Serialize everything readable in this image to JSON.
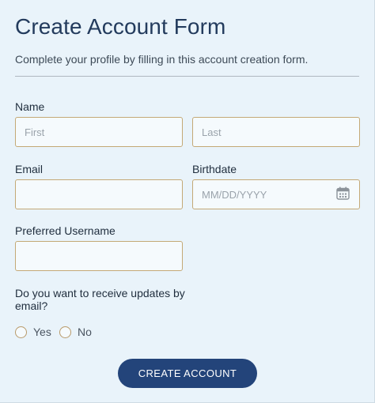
{
  "form": {
    "title": "Create Account Form",
    "subtitle": "Complete your profile by filling in this account creation form."
  },
  "fields": {
    "name_label": "Name",
    "first_placeholder": "First",
    "last_placeholder": "Last",
    "email_label": "Email",
    "email_value": "",
    "birthdate_label": "Birthdate",
    "birthdate_placeholder": "MM/DD/YYYY",
    "birthdate_icon": "calendar-icon",
    "username_label": "Preferred Username",
    "username_value": ""
  },
  "updates": {
    "question": "Do you want to receive updates by email?",
    "options": [
      "Yes",
      "No"
    ],
    "selected": null
  },
  "submit": {
    "label": "CREATE ACCOUNT"
  },
  "colors": {
    "background": "#e9f3fa",
    "title": "#233b5d",
    "field_border": "#c4a976",
    "button": "#23447a",
    "button_text": "#ffffff"
  }
}
